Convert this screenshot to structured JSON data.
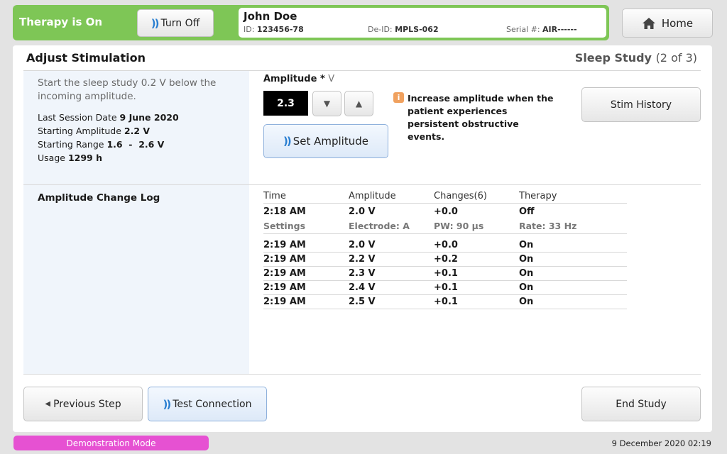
{
  "header": {
    "therapy_status": "Therapy is On",
    "turn_off_label": "Turn Off",
    "patient_name": "John Doe",
    "id_label": "ID:",
    "id_value": "123456-78",
    "deid_label": "De-ID:",
    "deid_value": "MPLS-062",
    "serial_label": "Serial #:",
    "serial_value": "AIR------",
    "home_label": "Home"
  },
  "main": {
    "title": "Adjust Stimulation",
    "step_title": "Sleep Study",
    "step_progress": "(2 of 3)",
    "intro_text": "Start the sleep study 0.2 V below the incoming amplitude.",
    "info": [
      {
        "label": "Last Session Date",
        "value": "9 June 2020"
      },
      {
        "label": "Starting Amplitude",
        "value": "2.2 V"
      },
      {
        "label": "Starting Range",
        "value": "1.6  -  2.6 V"
      },
      {
        "label": "Usage",
        "value": "1299 h"
      }
    ],
    "amplitude_label": "Amplitude *",
    "amplitude_unit": "V",
    "amplitude_value": "2.3",
    "set_amplitude_label": "Set Amplitude",
    "warning_text": "Increase amplitude when the patient experiences persistent obstructive events.",
    "stim_history_label": "Stim History",
    "log_title": "Amplitude Change Log",
    "log_headers": [
      "Time",
      "Amplitude",
      "Changes(6)",
      "Therapy"
    ],
    "log_first": [
      "2:18 AM",
      "2.0 V",
      "+0.0",
      "Off"
    ],
    "log_settings": [
      "Settings",
      "Electrode: A",
      "PW: 90 µs",
      "Rate: 33 Hz"
    ],
    "log_rows": [
      [
        "2:19 AM",
        "2.0 V",
        "+0.0",
        "On"
      ],
      [
        "2:19 AM",
        "2.2 V",
        "+0.2",
        "On"
      ],
      [
        "2:19 AM",
        "2.3 V",
        "+0.1",
        "On"
      ],
      [
        "2:19 AM",
        "2.4 V",
        "+0.1",
        "On"
      ],
      [
        "2:19 AM",
        "2.5 V",
        "+0.1",
        "On"
      ]
    ]
  },
  "footer": {
    "previous_label": "Previous Step",
    "test_connection_label": "Test Connection",
    "end_study_label": "End Study",
    "demo_label": "Demonstration Mode",
    "datetime": "9 December 2020 02:19"
  },
  "icons": {
    "wireless": "wireless-signal-icon",
    "home": "home-icon",
    "info": "info-icon"
  },
  "colors": {
    "therapy_green": "#7ec656",
    "demo_pink": "#e651d2",
    "wireless_blue": "#2a7fd1",
    "warning_orange": "#f0a15f"
  }
}
